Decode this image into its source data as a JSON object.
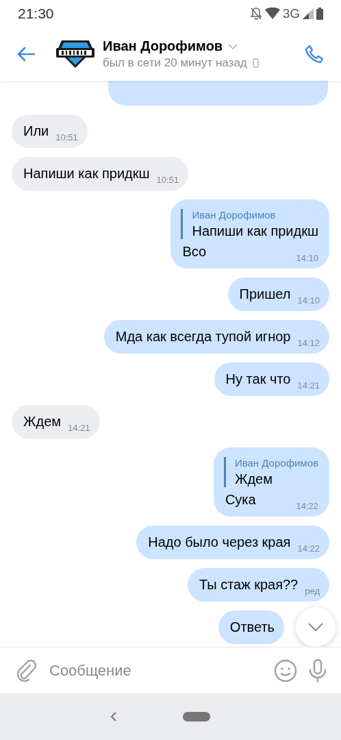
{
  "status_bar": {
    "time": "21:30",
    "network": "3G"
  },
  "header": {
    "name": "Иван Дорофимов",
    "status": "был в сети 20 минут назад"
  },
  "messages": [
    {
      "out": false,
      "text": "Или",
      "time": "10:51"
    },
    {
      "out": false,
      "text": "Напиши как придкш",
      "time": "10:51"
    },
    {
      "out": true,
      "reply": {
        "author": "Иван Дорофимов",
        "text": "Напиши как придкш"
      },
      "text": "Всо",
      "time": "14:10"
    },
    {
      "out": true,
      "text": "Пришел",
      "time": "14:10"
    },
    {
      "out": true,
      "text": "Мда как всегда тупой игнор",
      "time": "14:12"
    },
    {
      "out": true,
      "text": "Ну так что",
      "time": "14:21"
    },
    {
      "out": false,
      "text": "Ждем",
      "time": "14:21"
    },
    {
      "out": true,
      "reply": {
        "author": "Иван Дорофимов",
        "text": "Ждем"
      },
      "text": "Сука",
      "time": "14:22"
    },
    {
      "out": true,
      "text": "Надо было через края",
      "time": "14:22"
    },
    {
      "out": true,
      "text": "Ты стаж края??",
      "time": "ред"
    },
    {
      "out": true,
      "text": "Ответь"
    }
  ],
  "composer": {
    "placeholder": "Сообщение"
  }
}
